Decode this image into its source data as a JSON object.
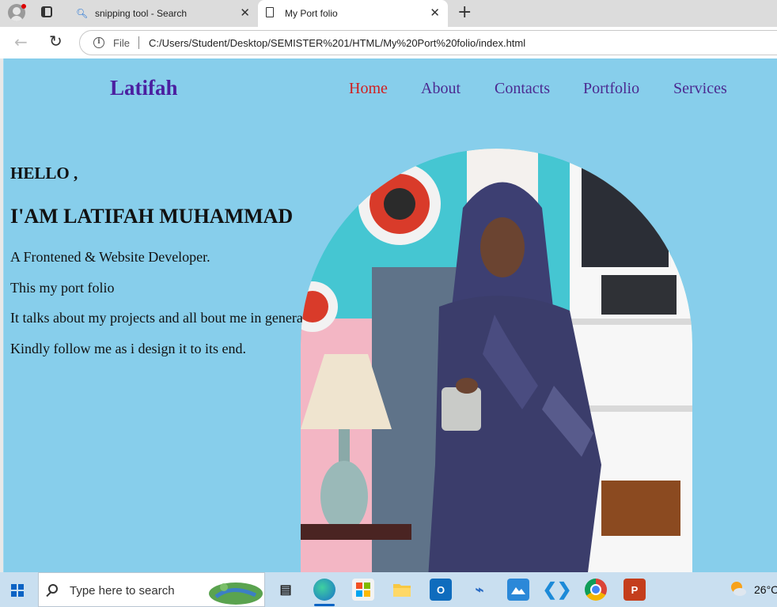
{
  "browser": {
    "tabs": [
      {
        "label": "snipping tool - Search",
        "icon": "search-icon"
      },
      {
        "label": "My Port folio",
        "icon": "page-icon",
        "active": true
      }
    ],
    "address": {
      "scheme_label": "File",
      "url": "C:/Users/Student/Desktop/SEMISTER%201/HTML/My%20Port%20folio/index.html"
    }
  },
  "page": {
    "brand": "Latifah",
    "nav": [
      "Home",
      "About",
      "Contacts",
      "Portfolio",
      "Services"
    ],
    "active_nav": "Home",
    "hello": "HELLO ,",
    "name": "I'AM LATIFAH MUHAMMAD",
    "paragraphs": [
      "A Frontened & Website Developer.",
      "This my port folio",
      "It talks about my projects and all bout me in general.",
      "Kindly follow me as i design it to its end."
    ],
    "colors": {
      "background": "#87ceeb",
      "brand": "#4b1fa0",
      "nav": "#4b2a90",
      "nav_active": "#d11f1f"
    }
  },
  "taskbar": {
    "search_placeholder": "Type here to search",
    "apps": [
      "task-view-icon",
      "edge-icon",
      "store-icon",
      "file-explorer-icon",
      "outlook-icon",
      "rdp-icon",
      "photos-icon",
      "vscode-icon",
      "chrome-icon",
      "powerpoint-icon"
    ],
    "temperature": "26°C"
  }
}
